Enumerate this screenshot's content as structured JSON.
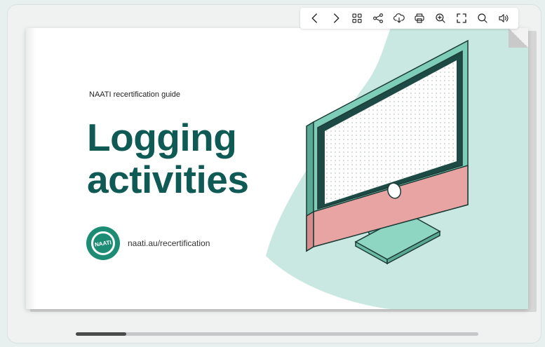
{
  "toolbar": {
    "buttons": [
      {
        "name": "prev-page-button",
        "icon": "chevron-left-icon"
      },
      {
        "name": "next-page-button",
        "icon": "chevron-right-icon"
      },
      {
        "name": "thumbnails-button",
        "icon": "grid-icon"
      },
      {
        "name": "share-button",
        "icon": "share-icon"
      },
      {
        "name": "download-button",
        "icon": "cloud-download-icon"
      },
      {
        "name": "print-button",
        "icon": "print-icon"
      },
      {
        "name": "zoom-in-button",
        "icon": "zoom-in-icon"
      },
      {
        "name": "fullscreen-button",
        "icon": "fullscreen-icon"
      },
      {
        "name": "search-button",
        "icon": "search-icon"
      },
      {
        "name": "sound-button",
        "icon": "speaker-icon"
      }
    ]
  },
  "page": {
    "subtitle": "NAATI recertification guide",
    "title_line1": "Logging",
    "title_line2": "activities",
    "logo_text": "NAATI",
    "url": "naati.au/recertification"
  },
  "colors": {
    "accent_teal": "#0f5a55",
    "mint": "#c9e8e1",
    "screen_frame": "#7ecdb8",
    "pink": "#e8a3a3"
  },
  "scrollbar": {
    "position_fraction": 0.0
  }
}
